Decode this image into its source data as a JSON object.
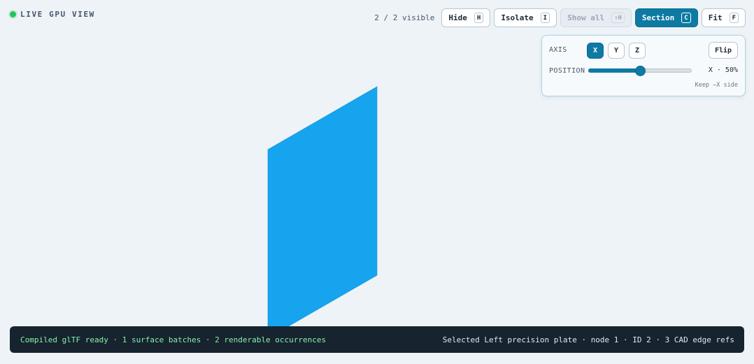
{
  "live": {
    "label": "LIVE GPU VIEW",
    "dot_color": "#22c55e"
  },
  "toolbar": {
    "visible_count": "2 / 2 visible",
    "buttons": [
      {
        "label": "Hide",
        "key": "H",
        "state": "normal"
      },
      {
        "label": "Isolate",
        "key": "I",
        "state": "normal"
      },
      {
        "label": "Show all",
        "key": "⇧H",
        "state": "disabled"
      },
      {
        "label": "Section",
        "key": "C",
        "state": "active"
      },
      {
        "label": "Fit",
        "key": "F",
        "state": "normal"
      }
    ]
  },
  "section_panel": {
    "axis_label": "AXIS",
    "axes": [
      "X",
      "Y",
      "Z"
    ],
    "selected_axis": "X",
    "flip_label": "Flip",
    "position_label": "POSITION",
    "position_fraction": 0.5,
    "position_value": "X · 50%",
    "keep_side": "Keep −X side"
  },
  "viewport": {
    "selected_color": "#16a4ee"
  },
  "status": {
    "left": "Compiled glTF ready · 1 surface batches · 2 renderable occurrences",
    "right": "Selected Left precision plate · node 1 · ID 2 · 3 CAD edge refs"
  },
  "colors": {
    "accent": "#0e7aa3",
    "background": "#eef3f8",
    "statusbar": "#17232e"
  }
}
